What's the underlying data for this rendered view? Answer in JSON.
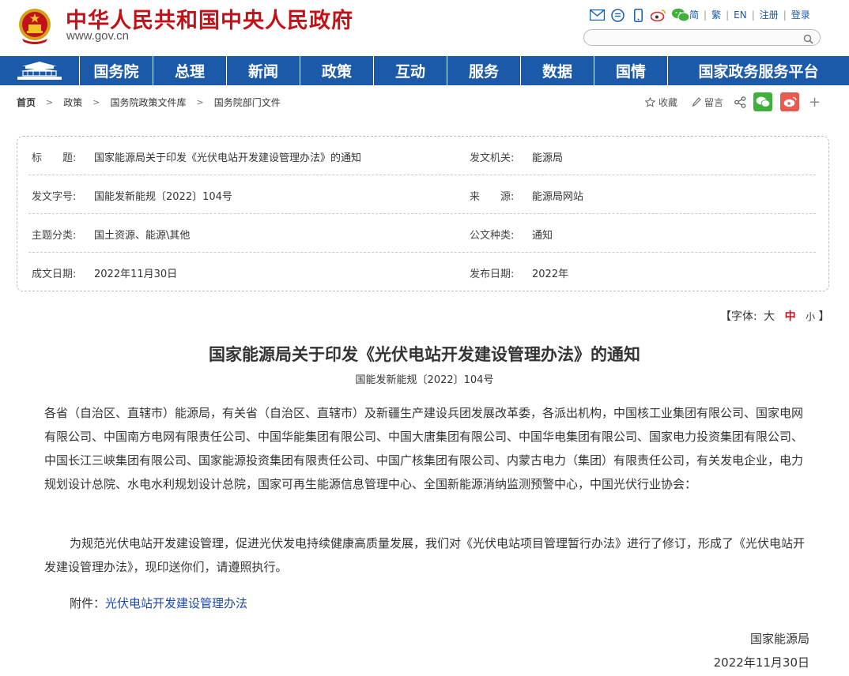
{
  "header": {
    "title": "中华人民共和国中央人民政府",
    "url": "www.gov.cn",
    "top_icons": [
      "mail-icon",
      "message-icon",
      "mobile-icon",
      "weibo-icon",
      "wechat-icon"
    ],
    "links": [
      "简",
      "繁",
      "EN",
      "注册",
      "登录"
    ],
    "search_placeholder": ""
  },
  "nav": {
    "items": [
      "国务院",
      "总理",
      "新闻",
      "政策",
      "互动",
      "服务",
      "数据",
      "国情",
      "国家政务服务平台"
    ]
  },
  "breadcrumb": [
    "首页",
    "政策",
    "国务院政策文件库",
    "国务院部门文件"
  ],
  "share": {
    "favorite": "收藏",
    "comment": "留言",
    "plus": "+"
  },
  "info": {
    "rows": [
      {
        "l1": "标　　题:",
        "v1": "国家能源局关于印发《光伏电站开发建设管理办法》的通知",
        "l2": "发文机关:",
        "v2": "能源局"
      },
      {
        "l1": "发文字号:",
        "v1": "国能发新能规〔2022〕104号",
        "l2": "来　　源:",
        "v2": "能源局网站"
      },
      {
        "l1": "主题分类:",
        "v1": "国土资源、能源\\其他",
        "l2": "公文种类:",
        "v2": "通知"
      },
      {
        "l1": "成文日期:",
        "v1": "2022年11月30日",
        "l2": "发布日期:",
        "v2": "2022年"
      }
    ]
  },
  "fontsize": {
    "open": "【字体:",
    "large": "大",
    "medium": "中",
    "small": "小",
    "close": "】"
  },
  "article": {
    "title": "国家能源局关于印发《光伏电站开发建设管理办法》的通知",
    "doc_number": "国能发新能规〔2022〕104号",
    "addressees": "各省（自治区、直辖市）能源局，有关省（自治区、直辖市）及新疆生产建设兵团发展改革委，各派出机构，中国核工业集团有限公司、国家电网有限公司、中国南方电网有限责任公司、中国华能集团有限公司、中国大唐集团有限公司、中国华电集团有限公司、国家电力投资集团有限公司、中国长江三峡集团有限公司、国家能源投资集团有限责任公司、中国广核集团有限公司、内蒙古电力（集团）有限责任公司，有关发电企业，电力规划设计总院、水电水利规划设计总院，国家可再生能源信息管理中心、全国新能源消纳监测预警中心，中国光伏行业协会：",
    "body": "为规范光伏电站开发建设管理，促进光伏发电持续健康高质量发展，我们对《光伏电站项目管理暂行办法》进行了修订，形成了《光伏电站开发建设管理办法》，现印送你们，请遵照执行。",
    "attachment_label": "附件：",
    "attachment_link": "光伏电站开发建设管理办法",
    "signature_org": "国家能源局",
    "signature_date": "2022年11月30日"
  },
  "colors": {
    "brand_red": "#c1121a",
    "nav_blue": "#1b5aa8",
    "link_blue": "#1b47b0",
    "wechat_green": "#3fb13a",
    "weibo_red": "#e8594f"
  }
}
